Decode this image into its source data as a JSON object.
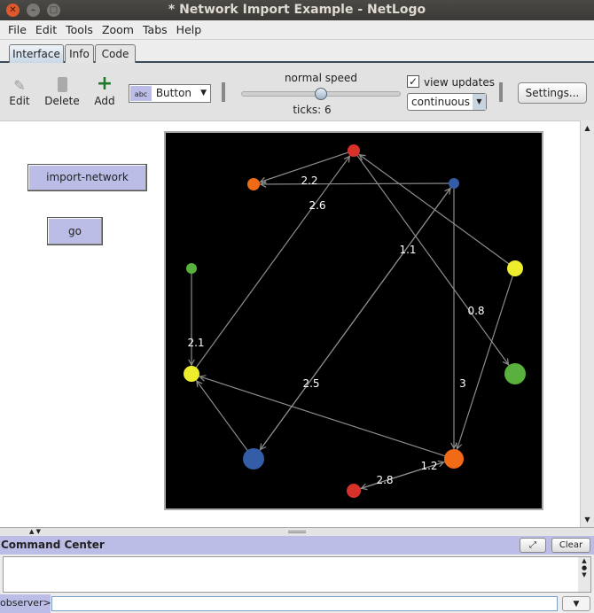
{
  "window": {
    "title": "* Network Import Example - NetLogo"
  },
  "menu": [
    "File",
    "Edit",
    "Tools",
    "Zoom",
    "Tabs",
    "Help"
  ],
  "tabs": [
    {
      "label": "Interface",
      "active": true
    },
    {
      "label": "Info"
    },
    {
      "label": "Code"
    }
  ],
  "toolbar": {
    "edit": "Edit",
    "delete": "Delete",
    "add": "Add",
    "widget_select": "Button",
    "speed_label": "normal speed",
    "speed_fraction": 0.5,
    "ticks": "ticks: 6",
    "view_updates": "view updates",
    "view_updates_checked": true,
    "update_mode": "continuous",
    "settings": "Settings..."
  },
  "buttons": {
    "import": "import-network",
    "go": "go"
  },
  "view": {
    "background": "#000000",
    "nodes": [
      {
        "color": "#d73229"
      },
      {
        "color": "#f16a15"
      },
      {
        "color": "#345da8"
      },
      {
        "color": "#eded2e"
      },
      {
        "color": "#59b03c"
      },
      {
        "color": "#eded2e"
      },
      {
        "color": "#59b03c"
      },
      {
        "color": "#345da8"
      },
      {
        "color": "#f16a15"
      },
      {
        "color": "#d73229"
      }
    ],
    "link_labels": [
      "2.2",
      "2.6",
      "1.1",
      "0.8",
      "2.1",
      "2.5",
      "3",
      "1.2",
      "2.8"
    ]
  },
  "command_center": {
    "title": "Command Center",
    "clear": "Clear",
    "prompt": "observer>",
    "input": ""
  }
}
